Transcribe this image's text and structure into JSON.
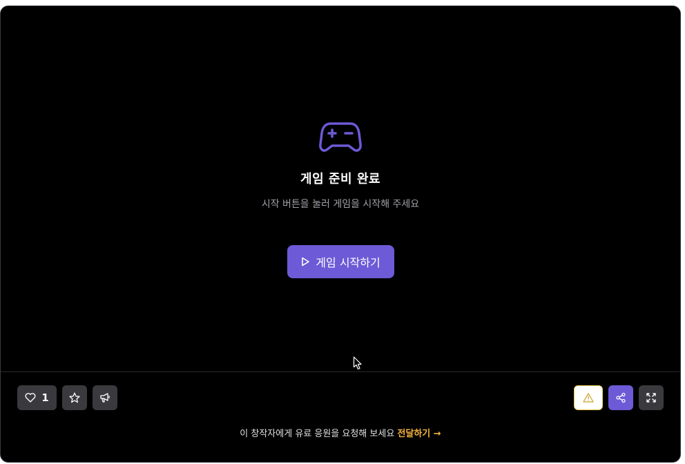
{
  "stage": {
    "title": "게임 준비 완료",
    "subtitle": "시작 버튼을 눌러 게임을 시작해 주세요",
    "start_button_label": "게임 시작하기",
    "icon": "gamepad-icon"
  },
  "toolbar": {
    "like_count": "1",
    "left_icons": [
      "heart-icon",
      "star-icon",
      "megaphone-icon"
    ],
    "right_icons": [
      "warning-icon",
      "share-icon",
      "fullscreen-icon"
    ]
  },
  "support": {
    "text": "이 창작자에게 유료 응원을 요청해 보세요",
    "link_label": "전달하기",
    "link_arrow": "→"
  },
  "colors": {
    "accent": "#6c5ad6",
    "link": "#f5b33a",
    "warning_border": "#e8c84a",
    "background": "#000000",
    "button_gray": "#3a3a3e"
  }
}
